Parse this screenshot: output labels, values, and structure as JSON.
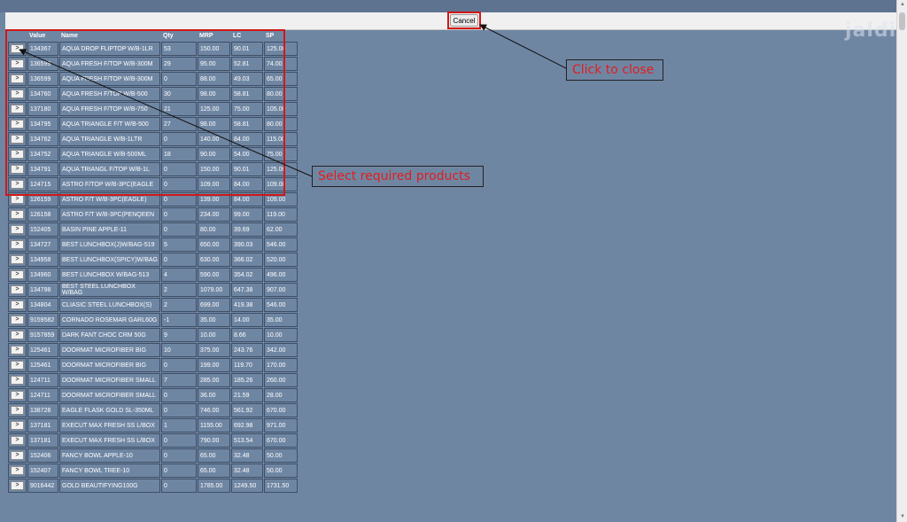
{
  "toolbar": {
    "cancel_label": "Cancel"
  },
  "watermark": "jaldi",
  "table": {
    "button_label": ">",
    "headers": [
      "",
      "Value",
      "Name",
      "Qty",
      "MRP",
      "LC",
      "SP"
    ],
    "rows": [
      [
        "134367",
        "AQUA DROP FLIPTOP W/B-1LR",
        "53",
        "150.00",
        "90.01",
        "125.00"
      ],
      [
        "136599",
        "AQUA FRESH F/TOP W/B-300M",
        "29",
        "95.00",
        "52.81",
        "74.00"
      ],
      [
        "136599",
        "AQUA FRESH F/TOP W/B-300M",
        "0",
        "88.00",
        "49.03",
        "65.00"
      ],
      [
        "134760",
        "AQUA FRESH F/TOP W/B-500",
        "30",
        "98.00",
        "58.81",
        "80.00"
      ],
      [
        "137180",
        "AQUA FRESH F/TOP W/B-750",
        "21",
        "125.00",
        "75.00",
        "105.00"
      ],
      [
        "134795",
        "AQUA TRIANGLE F/T W/B-500",
        "27",
        "98.00",
        "58.81",
        "80.00"
      ],
      [
        "134762",
        "AQUA TRIANGLE W/B-1LTR",
        "0",
        "140.00",
        "84.00",
        "115.00"
      ],
      [
        "134752",
        "AQUA TRIANGLE W/B-500ML",
        "18",
        "90.00",
        "54.00",
        "75.00"
      ],
      [
        "134791",
        "AQUA TRIANGL F/TOP W/B-1L",
        "0",
        "150.00",
        "90.01",
        "125.00"
      ],
      [
        "124715",
        "ASTRO F/TOP W/B-3PC(EAGLE",
        "0",
        "109.00",
        "84.00",
        "109.00"
      ],
      [
        "126159",
        "ASTRO F/T W/B-3PC(EAGLE)",
        "0",
        "139.00",
        "84.00",
        "109.00"
      ],
      [
        "126158",
        "ASTRO F/T W/B-3PC(PENQEEN",
        "0",
        "234.00",
        "99.00",
        "119.00"
      ],
      [
        "152405",
        "BASIN PINE APPLE-11",
        "0",
        "80.00",
        "39.69",
        "62.00"
      ],
      [
        "134727",
        "BEST LUNCHBOX(J)W/BAG-519",
        "5",
        "650.00",
        "390.03",
        "546.00"
      ],
      [
        "134958",
        "BEST LUNCHBOX(SPICY)W/BAG",
        "0",
        "630.00",
        "366.02",
        "520.00"
      ],
      [
        "134960",
        "BEST LUNCHBOX W/BAG-513",
        "4",
        "590.00",
        "354.02",
        "496.00"
      ],
      [
        "134798",
        "BEST STEEL LUNCHBOX W/BAG",
        "2",
        "1079.00",
        "647.38",
        "907.00"
      ],
      [
        "134804",
        "CLIASIC STEEL LUNCHBOX(S)",
        "2",
        "699.00",
        "419.38",
        "546.00"
      ],
      [
        "9159582",
        "CORNADO ROSEMAR GARL60G",
        "-1",
        "35.00",
        "14.00",
        "35.00"
      ],
      [
        "9157859",
        "DARK FANT CHOC CRM 50G",
        "9",
        "10.00",
        "8.66",
        "10.00"
      ],
      [
        "125461",
        "DOORMAT MICROFIBER BIG",
        "10",
        "375.00",
        "243.76",
        "342.00"
      ],
      [
        "125461",
        "DOORMAT MICROFIBER BIG",
        "0",
        "199.00",
        "119.70",
        "170.00"
      ],
      [
        "124711",
        "DOORMAT MICROFIBER SMALL",
        "7",
        "285.00",
        "185.26",
        "260.00"
      ],
      [
        "124711",
        "DOORMAT MICROFIBER SMALL",
        "0",
        "36.00",
        "21.59",
        "28.00"
      ],
      [
        "138728",
        "EAGLE FLASK GOLD SL-350ML",
        "0",
        "746.00",
        "561.92",
        "670.00"
      ],
      [
        "137181",
        "EXECUT MAX FRESH SS L/BOX",
        "1",
        "1155.00",
        "692.98",
        "971.00"
      ],
      [
        "137181",
        "EXECUT MAX FRESH SS L/BOX",
        "0",
        "790.00",
        "513.54",
        "670.00"
      ],
      [
        "152406",
        "FANCY BOWL APPLE-10",
        "0",
        "65.00",
        "32.48",
        "50.00"
      ],
      [
        "152407",
        "FANCY BOWL TREE-10",
        "0",
        "65.00",
        "32.48",
        "50.00"
      ],
      [
        "9016442",
        "GOLD BEAUTIFYING100G",
        "0",
        "1785.00",
        "1249.50",
        "1731.50"
      ]
    ]
  },
  "annotations": {
    "close_callout": "Click to close",
    "select_callout": "Select required products",
    "annotation_color": "#d01818"
  }
}
